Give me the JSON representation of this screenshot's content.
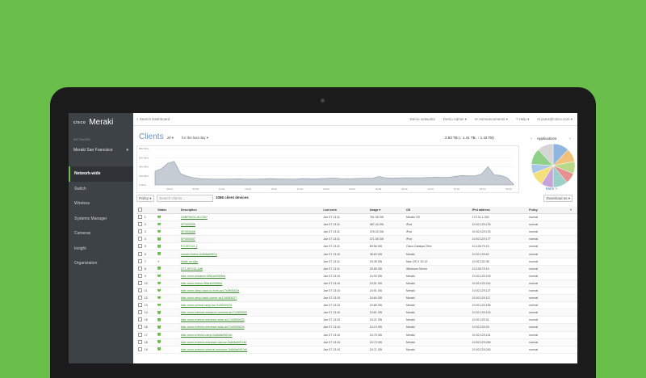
{
  "app": {
    "brand_small": "cisco",
    "brand": "Meraki"
  },
  "sidebar": {
    "network_label": "NETWORK",
    "network_value": "Meraki San Francisco",
    "items": [
      {
        "label": "Network-wide",
        "active": true
      },
      {
        "label": "Switch"
      },
      {
        "label": "Wireless"
      },
      {
        "label": "Systems Manager"
      },
      {
        "label": "Cameras"
      },
      {
        "label": "Insight"
      },
      {
        "label": "Organization"
      }
    ]
  },
  "topbar": {
    "search_placeholder": "Search Dashboard",
    "links": [
      "Demo networks",
      "Demo Admin ▾",
      "✉ Announcements ▾",
      "? Help ▾",
      "✉ jsoux@cisco.com ▾"
    ]
  },
  "clients": {
    "title": "Clients",
    "filter_all": "all ▾",
    "filter_range": "for the last day ▾",
    "usage_summary": "2.83 TB (↓ 1.41 TB, ↑ 1.42 TB)"
  },
  "chart_data": {
    "type": "area",
    "y_ticks": [
      "800 Mb/s",
      "600 Mb/s",
      "400 Mb/s",
      "200 Mb/s",
      "0 Mb/s"
    ],
    "x_ticks": [
      "09:00",
      "06:00",
      "12:00",
      "15:00",
      "18:00",
      "21:00",
      "00:00",
      "03:00",
      "06:00",
      "09:00",
      "12:00",
      "15:00",
      "18:00",
      "09:00"
    ],
    "ylim": [
      0,
      800
    ],
    "values": [
      300,
      360,
      480,
      520,
      250,
      190,
      160,
      140,
      135,
      130,
      128,
      130,
      132,
      135,
      130,
      128,
      130,
      135,
      140,
      135,
      132,
      130,
      134,
      140,
      138,
      136,
      140,
      145,
      150,
      142,
      138,
      140,
      145,
      148,
      150,
      185,
      160,
      150,
      155,
      160,
      158,
      160,
      162,
      168,
      170,
      165,
      170,
      190,
      210,
      200,
      205,
      240,
      400,
      220,
      210,
      160,
      20
    ],
    "color": "#c5ccd4"
  },
  "applications": {
    "label": "Applications",
    "prev": "‹",
    "next": "›",
    "more": "More »",
    "slices": [
      {
        "value": 12,
        "color": "#8fb6e0"
      },
      {
        "value": 10,
        "color": "#f0c27a"
      },
      {
        "value": 9,
        "color": "#b8d98a"
      },
      {
        "value": 8,
        "color": "#e88f8f"
      },
      {
        "value": 11,
        "color": "#9ad0c9"
      },
      {
        "value": 9,
        "color": "#c7a4d8"
      },
      {
        "value": 10,
        "color": "#f3e07a"
      },
      {
        "value": 7,
        "color": "#a9c6e8"
      },
      {
        "value": 12,
        "color": "#90d18a"
      },
      {
        "value": 12,
        "color": "#d5d5d5"
      }
    ]
  },
  "toolbar": {
    "policy": "Policy ▾",
    "search_placeholder": "Search clients...",
    "count": "1086 client devices",
    "download": "Download as ▾"
  },
  "table": {
    "headers": [
      "",
      "",
      "Status",
      "Description",
      "Last seen",
      "Usage ▾",
      "OS",
      "IPv4 address",
      "Policy",
      "+"
    ],
    "rows": [
      {
        "n": "1",
        "desc": "LMBP5E2A-W-C067",
        "seen": "Jan 07 13:11",
        "usage": "761.35 GB",
        "os": "Meraki OS",
        "ip": "172.31.1.254",
        "policy": "normal"
      },
      {
        "n": "2",
        "desc": "SPOE5205",
        "seen": "Jan 07 13:11",
        "usage": "387.44 GB",
        "os": "iPod",
        "ip": "10.92.129.176",
        "policy": "normal"
      },
      {
        "n": "3",
        "desc": "SPOE5406",
        "seen": "Jan 07 13:11",
        "usage": "376.33 GB",
        "os": "iPod",
        "ip": "10.92.129.176",
        "policy": "normal"
      },
      {
        "n": "4",
        "desc": "SPOE5407",
        "seen": "Jan 07 13:11",
        "usage": "371.55 GB",
        "os": "iPod",
        "ip": "10.92.129.177",
        "policy": "normal"
      },
      {
        "n": "5",
        "desc": "PS-SFO12-1",
        "seen": "Jan 07 13:11",
        "usage": "69.56 GB",
        "os": "Cisco Catalyst 29xx",
        "ip": "10.128.79.15",
        "policy": "normal"
      },
      {
        "n": "6",
        "desc": "meraki-fortive-0c6b8a0067a",
        "seen": "Jan 07 13:10",
        "usage": "38.63 GB",
        "os": "Meraki",
        "ip": "10.92.129.61",
        "policy": "normal"
      },
      {
        "n": "7",
        "desc": "fiddle-no-skin",
        "seen": "Jan 07 13:11",
        "usage": "29.45 GB",
        "os": "Mac OS X 10.12",
        "ip": "10.92.132.36",
        "policy": "normal"
      },
      {
        "n": "8",
        "desc": "DT1-SFO12-2dB",
        "seen": "Jan 07 13:11",
        "usage": "25.65 GB",
        "os": "Windows Server",
        "ip": "10.128.79.19",
        "policy": "normal"
      },
      {
        "n": "9",
        "desc": "bike-room-entrance-0f5a1e0089ba",
        "seen": "Jan 07 13:10",
        "usage": "24.93 GB",
        "os": "Meraki",
        "ip": "10.92.129.103",
        "policy": "normal"
      },
      {
        "n": "10",
        "desc": "bike-room-indoor-0f5a1e0096b0",
        "seen": "Jan 07 13:10",
        "usage": "24.91 GB",
        "os": "Meraki",
        "ip": "10.92.129.214",
        "policy": "normal"
      },
      {
        "n": "11",
        "desc": "bike-room-ramp-back-to-front-ac17c0f93002e",
        "seen": "Jan 07 13:10",
        "usage": "24.91 GB",
        "os": "Meraki",
        "ip": "10.92.129.127",
        "policy": "normal"
      },
      {
        "n": "12",
        "desc": "bike-room-ramp-back-corner-ac17c0f93027",
        "seen": "Jan 07 13:10",
        "usage": "24.84 GB",
        "os": "Meraki",
        "ip": "10.92.129.117",
        "policy": "normal"
      },
      {
        "n": "13",
        "desc": "bike-room-central-ramp-ac17c0f930033",
        "seen": "Jan 07 13:10",
        "usage": "24.65 GB",
        "os": "Meraki",
        "ip": "10.92.129.106",
        "policy": "normal"
      },
      {
        "n": "14",
        "desc": "bike-room-internal-entrance-covered-ac17c0f93003",
        "seen": "Jan 07 13:10",
        "usage": "24.61 GB",
        "os": "Meraki",
        "ip": "10.92.129.103",
        "policy": "normal"
      },
      {
        "n": "15",
        "desc": "bike-room-exterior-entrance-wide-ac17c0f930033",
        "seen": "Jan 07 13:10",
        "usage": "24.21 GB",
        "os": "Meraki",
        "ip": "10.92.129.31",
        "policy": "normal"
      },
      {
        "n": "16",
        "desc": "bike-room-exterior-entrance-wide-ac17c0f930024",
        "seen": "Jan 07 13:10",
        "usage": "24.19 GB",
        "os": "Meraki",
        "ip": "10.92.129.29",
        "policy": "normal"
      },
      {
        "n": "17",
        "desc": "bike-room-exterior-ramp-0c6b8a0067a0",
        "seen": "Jan 07 13:10",
        "usage": "24.75 GB",
        "os": "Meraki",
        "ip": "10.92.129.141",
        "policy": "normal"
      },
      {
        "n": "18",
        "desc": "bike-room-exterior-entrance-narrow-0c6b8a0067a0",
        "seen": "Jan 07 13:10",
        "usage": "24.73 GB",
        "os": "Meraki",
        "ip": "10.92.129.245",
        "policy": "normal"
      },
      {
        "n": "19",
        "desc": "bike-room-exterior-internal-entrance-0c6b8a0067a0",
        "seen": "Jan 07 13:10",
        "usage": "24.71 GB",
        "os": "Meraki",
        "ip": "10.92.129.243",
        "policy": "normal"
      }
    ]
  }
}
